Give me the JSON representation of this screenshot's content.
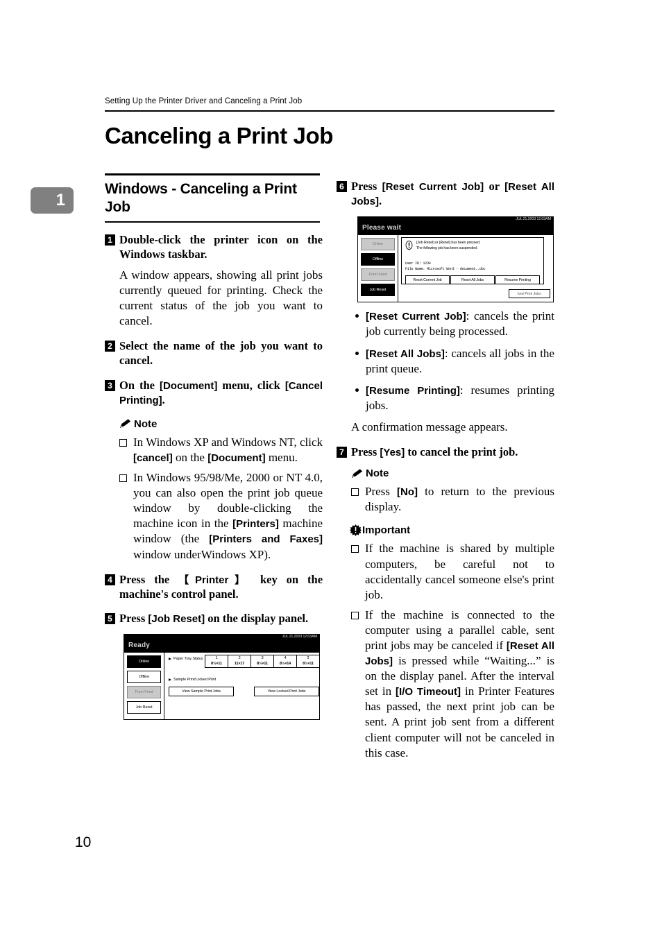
{
  "running_head": "Setting Up the Printer Driver and Canceling a Print Job",
  "chapter_number": "1",
  "page_title": "Canceling a Print Job",
  "folio": "10",
  "left_column": {
    "section_title": "Windows - Canceling a Print Job",
    "step1": {
      "number": "1",
      "text": "Double-click the printer icon on the Windows taskbar.",
      "body": "A window appears, showing all print jobs currently queued for printing. Check the current status of the job you want to cancel."
    },
    "step2": {
      "number": "2",
      "text": "Select the name of the job you want to cancel."
    },
    "step3": {
      "number": "3",
      "text_a": "On the ",
      "ui_a": "[Document]",
      "text_b": " menu, click ",
      "ui_b": "[Cancel Printing]",
      "text_c": "."
    },
    "note_label": "Note",
    "note_items": [
      {
        "a": "In Windows XP and Windows NT, click ",
        "ui1": "[cancel]",
        "b": " on the ",
        "ui2": "[Document]",
        "c": " menu."
      },
      {
        "a": "In Windows 95/98/Me, 2000 or NT 4.0, you can also open the print job queue window by double-clicking the machine icon in the ",
        "ui1": "[Printers]",
        "b": " machine window (the ",
        "ui2": "[Printers and Faxes]",
        "c": " window underWindows XP)."
      }
    ],
    "step4": {
      "number": "4",
      "text_a": "Press the ",
      "ui_a": "【Printer】",
      "text_b": " key on the machine's control panel."
    },
    "step5": {
      "number": "5",
      "text_a": "Press ",
      "ui_a": "[Job Reset]",
      "text_b": " on the display panel."
    }
  },
  "right_column": {
    "step6": {
      "number": "6",
      "text_a": "Press ",
      "ui_a": "[Reset Current Job]",
      "text_b": " or ",
      "ui_b": "[Reset All Jobs]",
      "text_c": "."
    },
    "button_descriptions": [
      {
        "ui": "[Reset Current Job]",
        "text": ": cancels the print job currently being processed."
      },
      {
        "ui": "[Reset All Jobs]",
        "text": ": cancels all jobs in the print queue."
      },
      {
        "ui": "[Resume Printing]",
        "text": ": resumes printing jobs."
      }
    ],
    "confirmation_line": "A confirmation message appears.",
    "step7": {
      "number": "7",
      "text_a": "Press ",
      "ui_a": "[Yes]",
      "text_b": " to cancel the print job."
    },
    "note_label": "Note",
    "note_items": [
      {
        "a": "Press ",
        "ui1": "[No]",
        "b": " to return to the previous display.",
        "ui2": "",
        "c": ""
      }
    ],
    "important_label": "Important",
    "important_items": [
      {
        "a": "If the machine is shared by multiple computers, be careful not to accidentally cancel someone else's print job.",
        "ui1": "",
        "b": "",
        "ui2": "",
        "c": ""
      },
      {
        "a": "If the machine is connected to the computer using a parallel cable, sent print jobs may be canceled if ",
        "ui1": "[Reset All Jobs]",
        "b": " is pressed while “Waiting...” is on the display panel. After the interval set in ",
        "ui2": "[I/O Timeout]",
        "c": " in Printer Features has passed, the next print job can be sent. A print job sent from a different client computer will not be canceled in this case."
      }
    ]
  },
  "panel_ready": {
    "timestamp": "JUL  21,2003 12:03AM",
    "status": "Ready",
    "side_buttons": [
      {
        "label": "Online",
        "state": "selected"
      },
      {
        "label": "Offline",
        "state": "normal"
      },
      {
        "label": "Form Feed",
        "state": "dimmed"
      },
      {
        "label": "Job Reset",
        "state": "normal"
      }
    ],
    "tray_status_label": "Paper Tray Status",
    "trays": [
      {
        "index": "1",
        "size": "8½×11"
      },
      {
        "index": "2",
        "size": "11×17"
      },
      {
        "index": "3",
        "size": "8½×11"
      },
      {
        "index": "4",
        "size": "8½×14"
      },
      {
        "index": "↧",
        "size": "8½×11"
      }
    ],
    "sample_label": "Sample Print/Locked Print",
    "wide_buttons": [
      "View Sample Print Jobs",
      "View Locked Print Jobs"
    ]
  },
  "panel_wait": {
    "timestamp": "JUL  21,2003 12:03AM",
    "status": "Please wait",
    "side_buttons": [
      {
        "label": "Online",
        "state": "normal"
      },
      {
        "label": "Offline",
        "state": "selected"
      },
      {
        "label": "Form Feed",
        "state": "dimmed"
      },
      {
        "label": "Job Reset",
        "state": "selected"
      }
    ],
    "dialog": {
      "line1": "[Job Reset] or [Reset] has been pressed.",
      "line2": "The following job has been suspended.",
      "user_id": "User ID: 1234",
      "file_name": "File Name: Microsoft Word - document..doc",
      "buttons": [
        "Reset Current Job",
        "Reset All Jobs",
        "Resume Printing"
      ]
    },
    "ghost_button": "ked Print Jobs"
  }
}
